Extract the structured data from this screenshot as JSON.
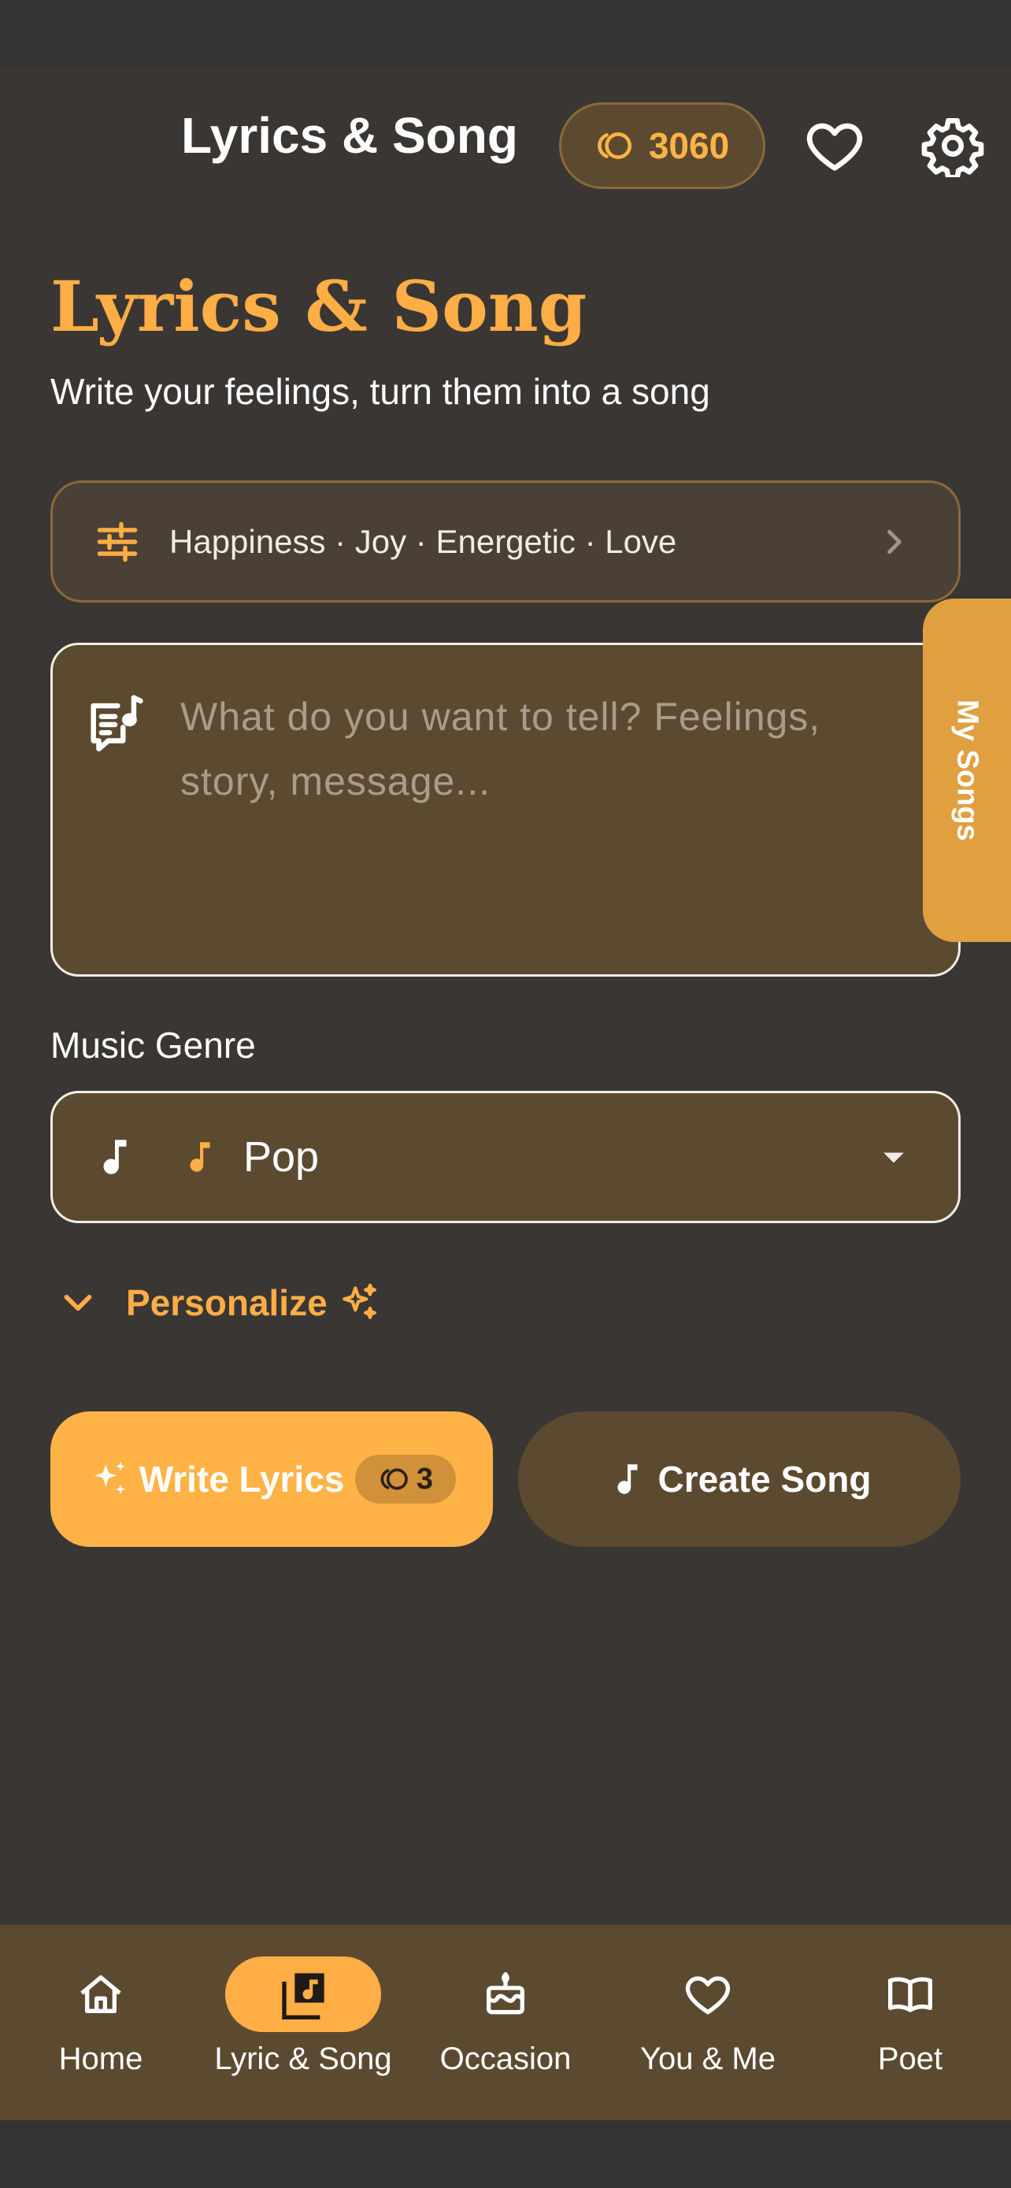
{
  "header": {
    "title": "Lyrics & Song",
    "coins": "3060",
    "icons": {
      "coin": "coin-icon",
      "favorites": "heart-icon",
      "settings": "gear-icon"
    }
  },
  "hero": {
    "title": "Lyrics & Song",
    "subtitle": "Write your feelings, turn them into a song"
  },
  "mood": {
    "text": "Happiness · Joy · Energetic · Love",
    "icon": "tune-icon"
  },
  "lyrics_input": {
    "value": "",
    "placeholder": "What do you want to tell? Feelings, story, message..."
  },
  "side_tab": {
    "label": "My Songs"
  },
  "genre": {
    "label": "Music Genre",
    "selected": "Pop"
  },
  "personalize": {
    "label": "Personalize"
  },
  "actions": {
    "write_label": "Write Lyrics",
    "write_cost": "3",
    "create_label": "Create Song"
  },
  "bottom_nav": [
    {
      "label": "Home",
      "icon": "home-icon",
      "active": false
    },
    {
      "label": "Lyric & Song",
      "icon": "library-music-icon",
      "active": true
    },
    {
      "label": "Occasion",
      "icon": "cake-icon",
      "active": false
    },
    {
      "label": "You & Me",
      "icon": "heart-icon",
      "active": false
    },
    {
      "label": "Poet",
      "icon": "book-icon",
      "active": false
    }
  ],
  "colors": {
    "background": "#3a3634",
    "accent": "#ffad45",
    "surface": "#5c4a30",
    "tab": "#e0a040"
  }
}
